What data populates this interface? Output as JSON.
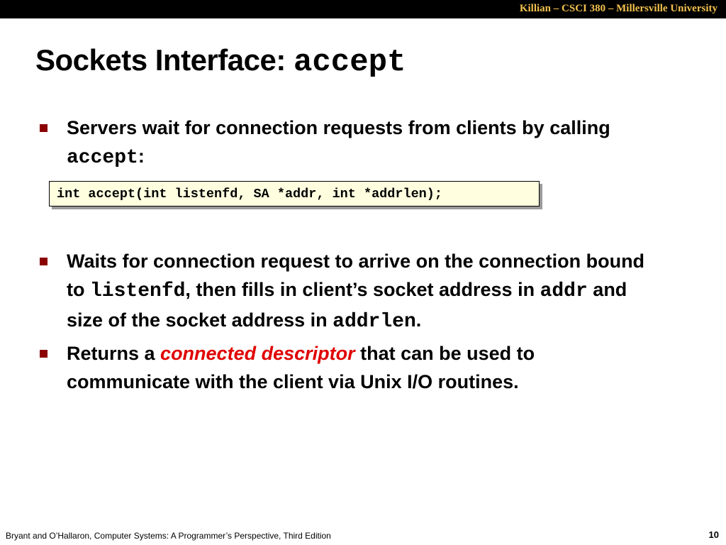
{
  "header": {
    "course": "Killian – CSCI 380 – Millersville University"
  },
  "title": {
    "text": "Sockets Interface: ",
    "code": "accept"
  },
  "bullets": [
    {
      "pre": "Servers wait for connection requests from clients by calling ",
      "code": "accept",
      "post": ":"
    },
    {
      "t1": "Waits for connection request to arrive on the connection bound to ",
      "c1": "listenfd",
      "t2": ", then fills in client’s socket address in ",
      "c2": "addr",
      "t3": " and size of the socket address in ",
      "c3": "addrlen",
      "t4": "."
    },
    {
      "pre": "Returns a ",
      "emph": "connected descriptor",
      "post": " that can be used to communicate with the client via Unix I/O routines."
    }
  ],
  "code_box": {
    "text": "int accept(int listenfd, SA *addr, int *addrlen);"
  },
  "footer": {
    "text": "Bryant and O’Hallaron, Computer Systems: A Programmer’s Perspective, Third Edition",
    "page": "10"
  },
  "colors": {
    "header_bg": "#000000",
    "header_text": "#f2c14e",
    "bullet_marker": "#8b0000",
    "emphasis": "#e00000",
    "code_bg": "#ffffe0"
  }
}
